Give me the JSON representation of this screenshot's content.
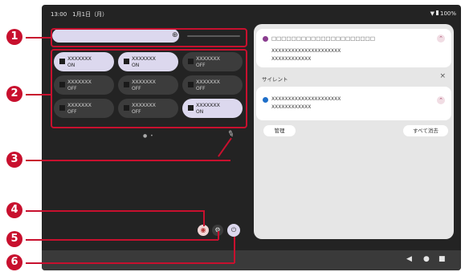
{
  "status_bar": {
    "time_date": "13:00　1月1日（月）",
    "battery": "100%"
  },
  "quick_tiles": [
    {
      "name": "XXXXXXX",
      "state": "ON",
      "on": true
    },
    {
      "name": "XXXXXXX",
      "state": "ON",
      "on": true
    },
    {
      "name": "XXXXXXX",
      "state": "OFF",
      "on": false
    },
    {
      "name": "XXXXXXX",
      "state": "OFF",
      "on": false
    },
    {
      "name": "XXXXXXX",
      "state": "OFF",
      "on": false
    },
    {
      "name": "XXXXXXX",
      "state": "OFF",
      "on": false
    },
    {
      "name": "XXXXXXX",
      "state": "OFF",
      "on": false
    },
    {
      "name": "XXXXXXX",
      "state": "OFF",
      "on": false
    },
    {
      "name": "XXXXXXX",
      "state": "ON",
      "on": true
    }
  ],
  "notifications": {
    "card1": {
      "title": "□□□□□□□□□□□□□□□□□□□□□",
      "line1": "XXXXXXXXXXXXXXXXXXXXX",
      "line2": "XXXXXXXXXXXX"
    },
    "silent_header": "サイレント",
    "close_symbol": "×",
    "card2": {
      "line1": "XXXXXXXXXXXXXXXXXXXXX",
      "line2": "XXXXXXXXXXXX"
    },
    "manage_label": "管理",
    "clear_all_label": "すべて消去"
  },
  "callouts": [
    "1",
    "2",
    "3",
    "4",
    "5",
    "6"
  ],
  "colors": {
    "accent": "#c8102e",
    "tile_on": "#dcd8ee",
    "panel_bg": "#232323"
  }
}
